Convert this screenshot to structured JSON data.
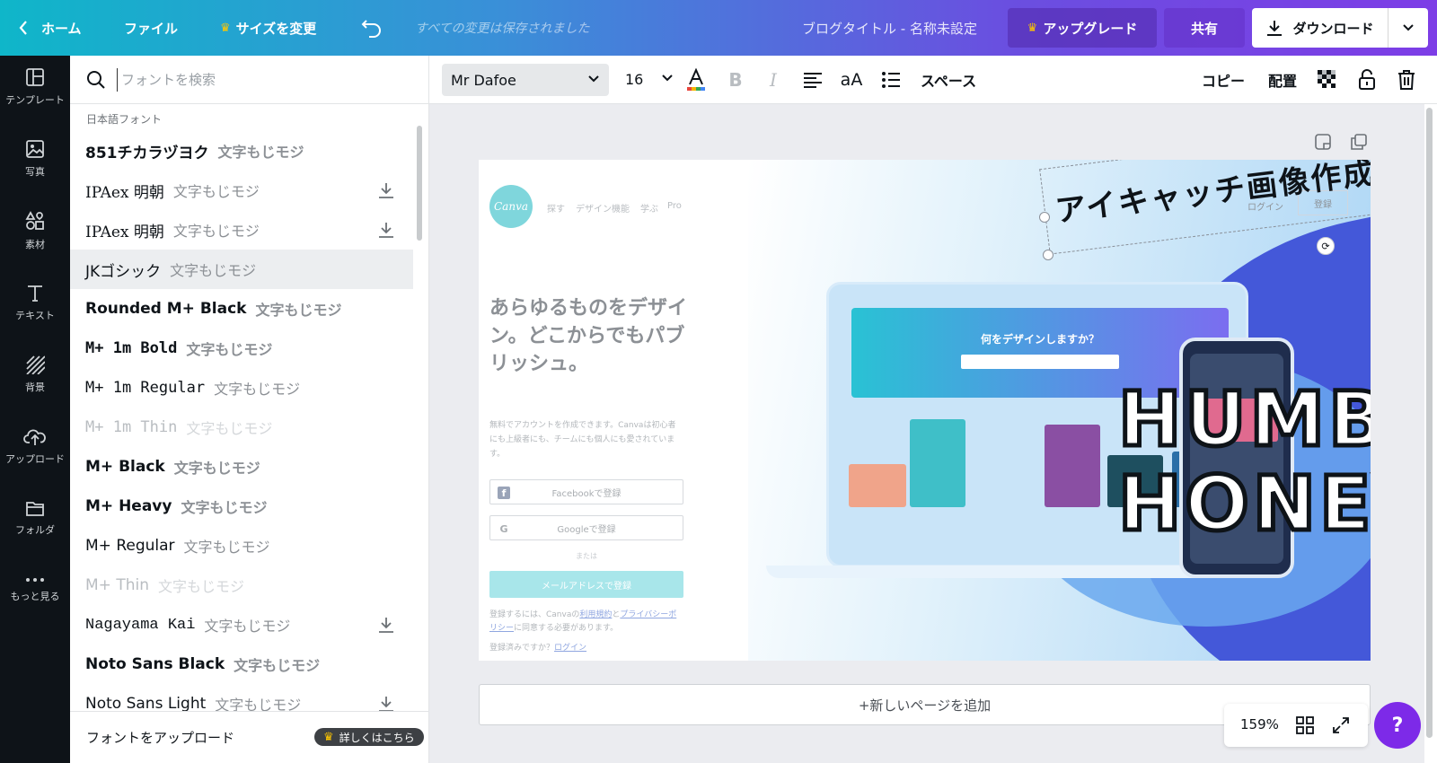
{
  "topbar": {
    "home": "ホーム",
    "file": "ファイル",
    "resize": "サイズを変更",
    "saved_status": "すべての変更は保存されました",
    "doc_title": "ブログタイトル - 名称未設定",
    "upgrade": "アップグレード",
    "share": "共有",
    "download": "ダウンロード"
  },
  "rail": [
    {
      "label": "テンプレート",
      "icon": "template-icon"
    },
    {
      "label": "写真",
      "icon": "photo-icon"
    },
    {
      "label": "素材",
      "icon": "elements-icon"
    },
    {
      "label": "テキスト",
      "icon": "text-icon"
    },
    {
      "label": "背景",
      "icon": "background-icon"
    },
    {
      "label": "アップロード",
      "icon": "upload-icon"
    },
    {
      "label": "フォルダ",
      "icon": "folder-icon"
    },
    {
      "label": "もっと見る",
      "icon": "more-icon"
    }
  ],
  "font_panel": {
    "search_placeholder": "フォントを検索",
    "section_label": "日本語フォント",
    "fonts": [
      {
        "name": "851チカラヅヨク",
        "sample": "文字もじモジ",
        "download": false
      },
      {
        "name": "IPAex 明朝",
        "sample": "文字もじモジ",
        "download": true
      },
      {
        "name": "IPAex 明朝",
        "sample": "文字もじモジ",
        "download": true
      },
      {
        "name": "JKゴシック",
        "sample": "文字もじモジ",
        "download": false
      },
      {
        "name": "Rounded M+ Black",
        "sample": "文字もじモジ",
        "download": false
      },
      {
        "name": "M+ 1m Bold",
        "sample": "文字もじモジ",
        "download": false
      },
      {
        "name": "M+ 1m Regular",
        "sample": "文字もじモジ",
        "download": false
      },
      {
        "name": "M+ 1m Thin",
        "sample": "文字もじモジ",
        "download": false
      },
      {
        "name": "M+ Black",
        "sample": "文字もじモジ",
        "download": false
      },
      {
        "name": "M+ Heavy",
        "sample": "文字もじモジ",
        "download": false
      },
      {
        "name": "M+ Regular",
        "sample": "文字もじモジ",
        "download": false
      },
      {
        "name": "M+ Thin",
        "sample": "文字もじモジ",
        "download": false
      },
      {
        "name": "Nagayama Kai",
        "sample": "文字もじモジ",
        "download": true
      },
      {
        "name": "Noto Sans Black",
        "sample": "文字もじモジ",
        "download": false
      },
      {
        "name": "Noto Sans Light",
        "sample": "文字もじモジ",
        "download": true
      }
    ],
    "highlighted_index": 3,
    "upload_fonts": "フォントをアップロード",
    "learn_more": "詳しくはこちら"
  },
  "toolbar": {
    "font_family": "Mr Dafoe",
    "font_size": "16",
    "spacing": "スペース",
    "copy": "コピー",
    "arrange": "配置"
  },
  "design": {
    "logo": "Canva",
    "nav": [
      "探す",
      "デザイン機能",
      "学ぶ",
      "Pro"
    ],
    "login_link": "ログイン",
    "register_btn": "登録",
    "heading": "あらゆるものをデザイン。どこからでもパブリッシュ。",
    "body": "無料でアカウントを作成できます。Canvaは初心者にも上級者にも、チームにも個人にも愛されています。",
    "facebook": "Facebookで登録",
    "google": "Googleで登録",
    "or": "または",
    "email_signup": "メールアドレスで登録",
    "terms_pre": "登録するには、Canvaの",
    "terms_link": "利用規約",
    "terms_mid": "と",
    "privacy_link": "プライバシーポリシー",
    "terms_post": "に同意する必要があります。",
    "already": "登録済みですか？",
    "already_link": "ログイン",
    "laptop_question": "何をデザインしますか？",
    "headline": "アイキャッチ画像作成に大活躍",
    "big_text_1": "HUMBLE",
    "big_text_2": "HONEY"
  },
  "add_page": "+新しいページを追加",
  "zoom": "159%",
  "help": "?",
  "colors": {
    "topbar_start": "#0fb6c9",
    "topbar_end": "#7d3de6",
    "rail_bg": "#0e1318",
    "help_purple": "#7d2ae8",
    "crown": "#ffc700"
  }
}
